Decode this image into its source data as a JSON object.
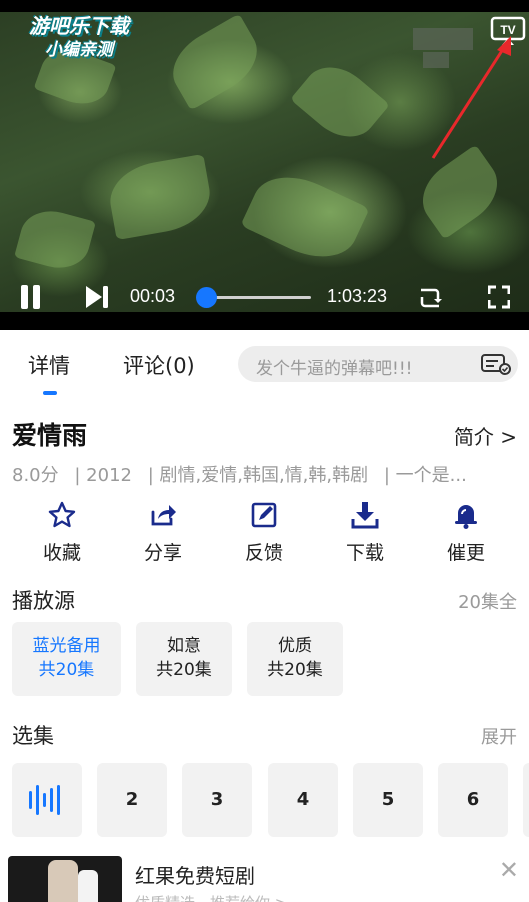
{
  "player": {
    "watermark_line1": "游吧乐下载",
    "watermark_line2": "小编亲测",
    "current_time": "00:03",
    "total_time": "1:03:23",
    "progress": 0.0001,
    "icons": [
      "pause-icon",
      "next-icon",
      "rotate-screen-icon",
      "fullscreen-icon",
      "tv-cast-icon"
    ],
    "tv_label": "TV",
    "annotation_color": "#e8282b"
  },
  "tabs": {
    "details": "详情",
    "comments": "评论(0)",
    "danmaku_placeholder": "发个牛逼的弹幕吧!!!"
  },
  "details": {
    "title": "爱情雨",
    "intro_link": "简介 >",
    "score": "8.0分",
    "year": "| 2012",
    "genres": "|  剧情,爱情,韩国,情,韩,韩剧",
    "desc": "|  一个是..."
  },
  "actions": [
    {
      "label": "收藏",
      "icon": "star-icon"
    },
    {
      "label": "分享",
      "icon": "share-icon"
    },
    {
      "label": "反馈",
      "icon": "feedback-icon"
    },
    {
      "label": "下载",
      "icon": "download-icon"
    },
    {
      "label": "催更",
      "icon": "bell-icon"
    }
  ],
  "sources": {
    "title": "播放源",
    "total": "20集全",
    "items": [
      {
        "name": "蓝光备用",
        "count": "共20集",
        "active": true
      },
      {
        "name": "如意",
        "count": "共20集",
        "active": false
      },
      {
        "name": "优质",
        "count": "共20集",
        "active": false
      }
    ]
  },
  "episodes": {
    "title": "选集",
    "expand": "展开",
    "playing_icon": "playing-bars-icon",
    "items": [
      "2",
      "3",
      "4",
      "5",
      "6"
    ]
  },
  "ad": {
    "title": "红果免费短剧",
    "subtitle": "优质精选，推荐给你 >",
    "close": "✕"
  },
  "colors": {
    "accent": "#1677ff",
    "muted": "#9a9a9a",
    "chip_bg": "#f2f2f2"
  }
}
